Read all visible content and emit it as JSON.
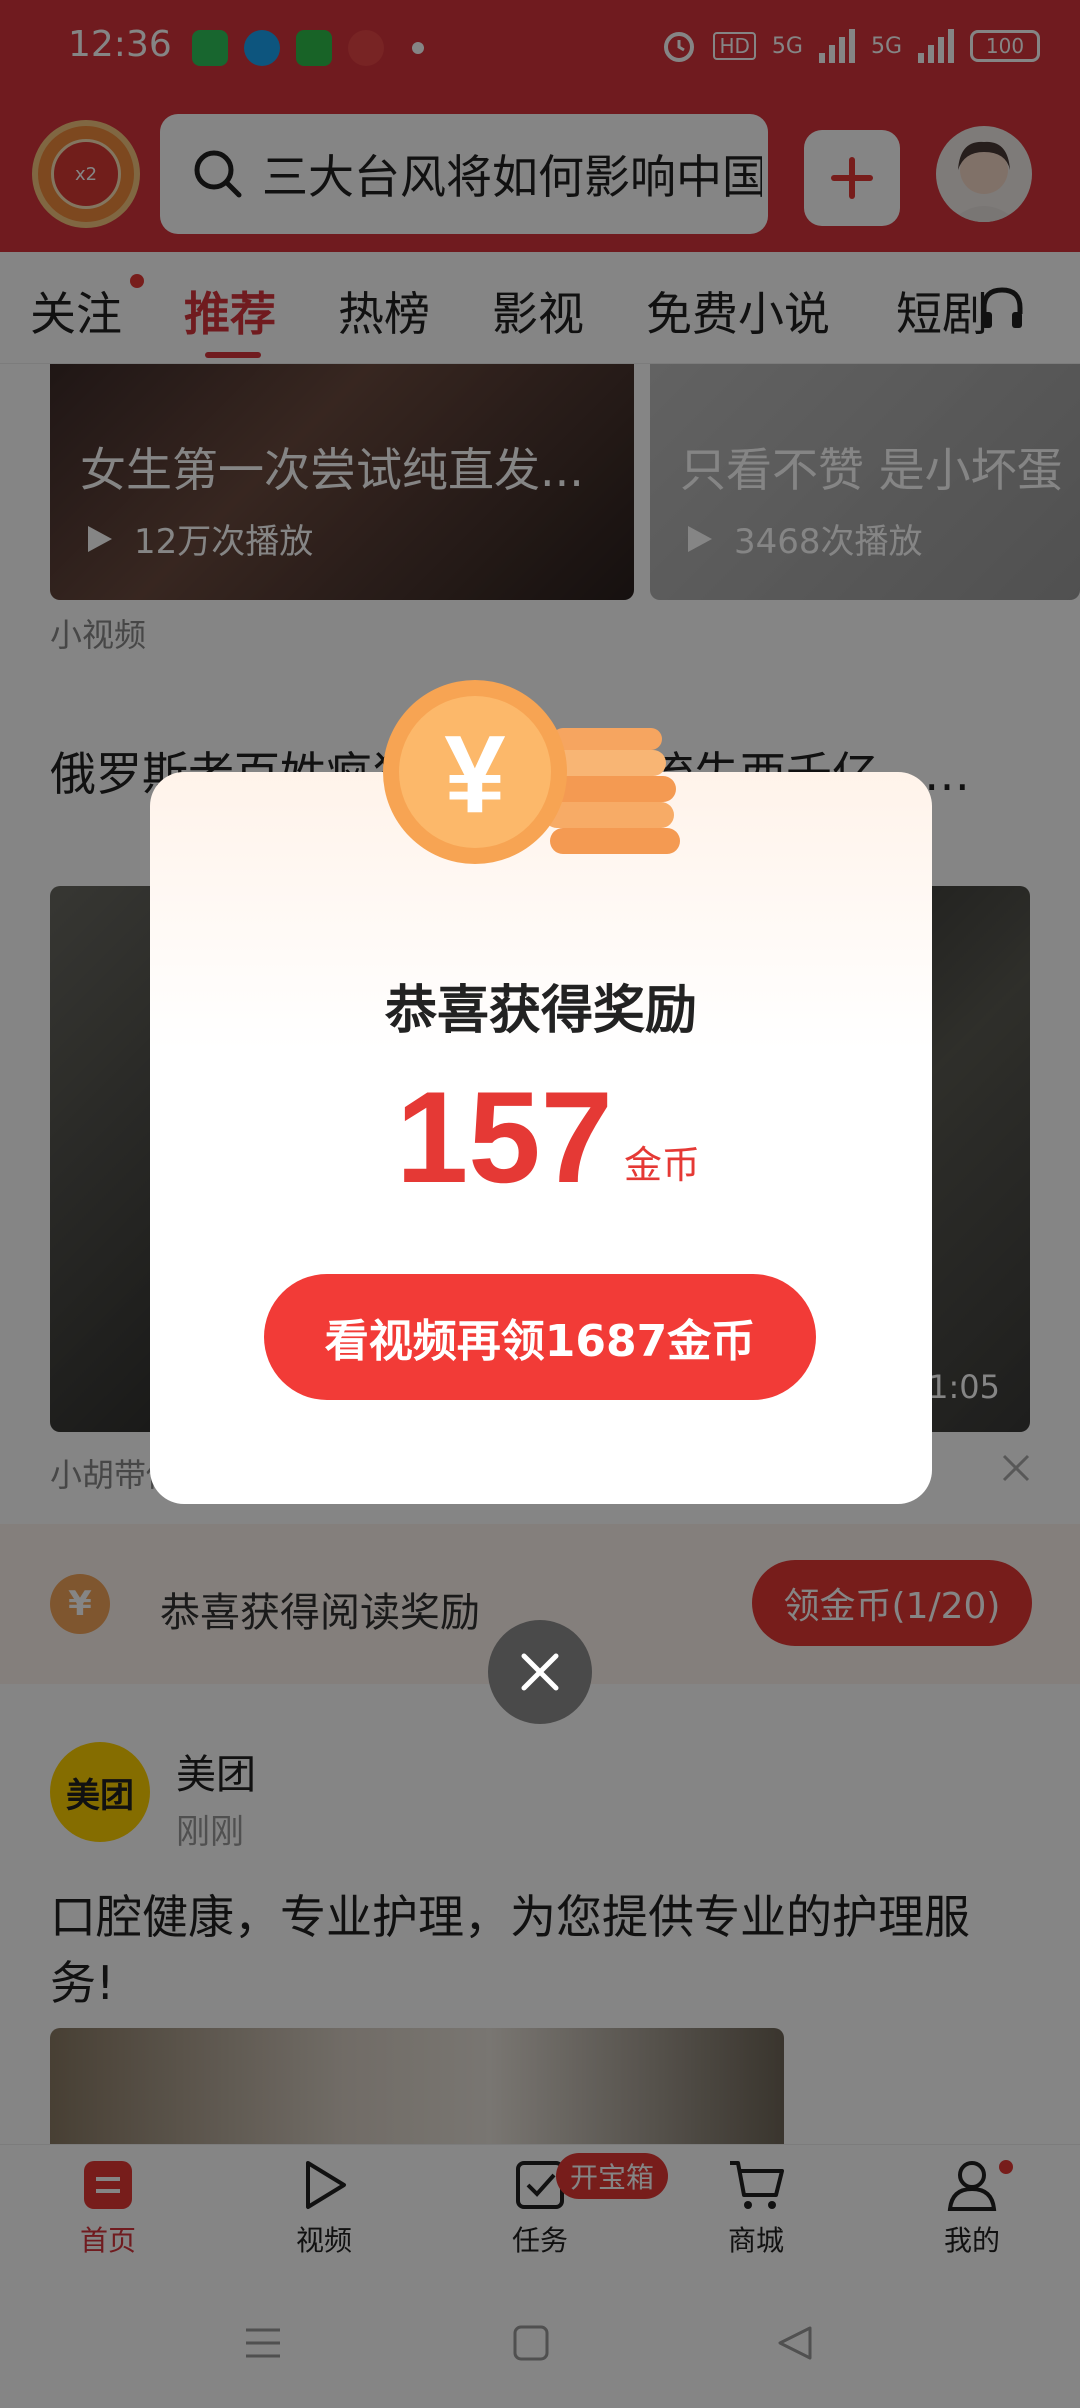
{
  "status_bar": {
    "time": "12:36",
    "hd_label": "HD",
    "net1": "5G",
    "net2": "5G",
    "battery": "100"
  },
  "header": {
    "search_text": "三大台风将如何影响中国",
    "hongbao_label": "x2"
  },
  "tabs": [
    "关注",
    "推荐",
    "热榜",
    "影视",
    "免费小说",
    "短剧"
  ],
  "feed": {
    "video1": {
      "title": "女生第一次尝试纯直发...",
      "plays": "12万次播放"
    },
    "video2": {
      "title": "只看不赞 是小坏蛋",
      "plays": "3468次播放"
    },
    "video_section_label": "小视频",
    "article": {
      "title": "俄罗斯老百姓疯狂……西西周流失西千亿，…",
      "duration": "1:05",
      "source": "小胡带你"
    },
    "reward_bar": {
      "label": "恭喜获得阅读奖励",
      "button": "领金币(1/20)"
    },
    "ad": {
      "logo_text": "美团",
      "name": "美团",
      "time": "刚刚",
      "body": "口腔健康，专业护理，为您提供专业的护理服务!"
    }
  },
  "bottom_nav": {
    "items": [
      "首页",
      "视频",
      "任务",
      "商城",
      "我的"
    ],
    "task_badge": "开宝箱"
  },
  "modal": {
    "title": "恭喜获得奖励",
    "amount": "157",
    "unit": "金币",
    "cta": "看视频再领1687金币"
  },
  "colors": {
    "brand_red": "#d6353c",
    "button_red": "#f23b37",
    "coin_orange": "#f3a55a"
  }
}
